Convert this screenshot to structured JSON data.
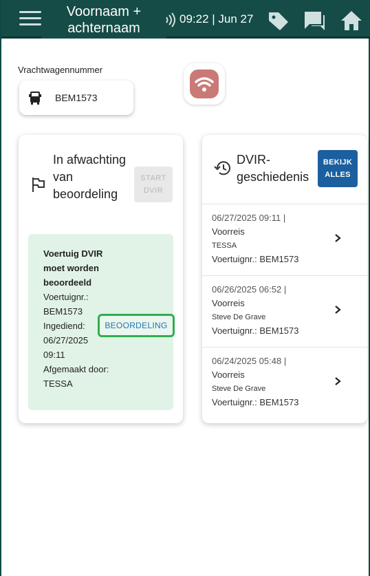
{
  "header": {
    "user_name": "Voornaam + achternaam",
    "time_date": "09:22 | Jun 27",
    "icons": [
      "menu-icon",
      "signal-icon",
      "tag-icon",
      "chat-icon",
      "home-icon"
    ]
  },
  "truck": {
    "label": "Vrachtwagennummer",
    "number": "BEM1573"
  },
  "pending": {
    "title": "In afwachting van beoordeling",
    "start_button": "START DVIR",
    "notice": {
      "title": "Voertuig DVIR moet worden beoordeeld",
      "vehicle": "Voertuignr.: BEM1573",
      "submitted": "Ingediend: 06/27/2025 09:11",
      "completed_by": "Afgemaakt door: TESSA"
    },
    "review_button": "BEOORDELING"
  },
  "history": {
    "title": "DVIR-geschiedenis",
    "view_all_button": "BEKIJK ALLES",
    "items": [
      {
        "date": "06/27/2025 09:11 |",
        "trip": "Voorreis",
        "driver": "TESSA",
        "vehicle": "Voertuignr.: BEM1573"
      },
      {
        "date": "06/26/2025 06:52 |",
        "trip": "Voorreis",
        "driver": "Steve De Grave",
        "vehicle": "Voertuignr.: BEM1573"
      },
      {
        "date": "06/24/2025 05:48 |",
        "trip": "Voorreis",
        "driver": "Steve De Grave",
        "vehicle": "Voertuignr.: BEM1573"
      }
    ]
  },
  "colors": {
    "header_bg": "#154c47",
    "notice_bg": "#e1f3e6",
    "review_border": "#2fae4f",
    "view_all_bg": "#1c5f9e"
  }
}
